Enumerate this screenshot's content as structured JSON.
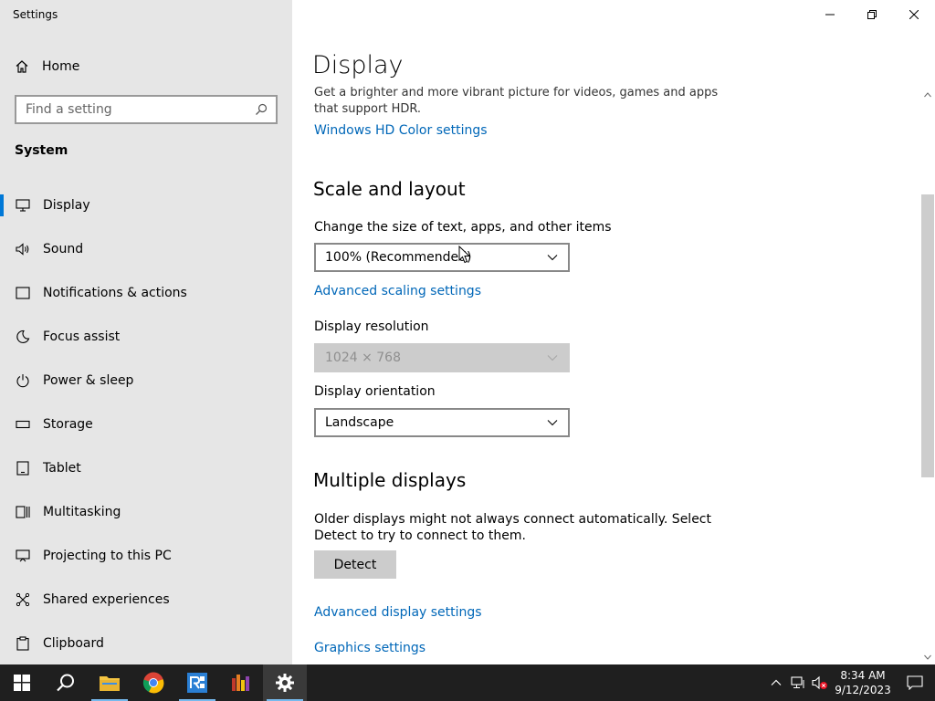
{
  "app": {
    "title": "Settings"
  },
  "sidebar": {
    "home_label": "Home",
    "search_placeholder": "Find a setting",
    "section": "System",
    "items": [
      {
        "label": "Display",
        "icon": "monitor-icon"
      },
      {
        "label": "Sound",
        "icon": "speaker-icon"
      },
      {
        "label": "Notifications & actions",
        "icon": "notification-icon"
      },
      {
        "label": "Focus assist",
        "icon": "moon-icon"
      },
      {
        "label": "Power & sleep",
        "icon": "power-icon"
      },
      {
        "label": "Storage",
        "icon": "storage-icon"
      },
      {
        "label": "Tablet",
        "icon": "tablet-icon"
      },
      {
        "label": "Multitasking",
        "icon": "multitasking-icon"
      },
      {
        "label": "Projecting to this PC",
        "icon": "projecting-icon"
      },
      {
        "label": "Shared experiences",
        "icon": "shared-icon"
      },
      {
        "label": "Clipboard",
        "icon": "clipboard-icon"
      }
    ]
  },
  "main": {
    "title": "Display",
    "hdr_description": "Get a brighter and more vibrant picture for videos, games and apps that support HDR.",
    "hdr_link": "Windows HD Color settings",
    "scale": {
      "heading": "Scale and layout",
      "size_label": "Change the size of text, apps, and other items",
      "size_value": "100% (Recommended)",
      "advanced_link": "Advanced scaling settings",
      "resolution_label": "Display resolution",
      "resolution_value": "1024 × 768",
      "orientation_label": "Display orientation",
      "orientation_value": "Landscape"
    },
    "multiple": {
      "heading": "Multiple displays",
      "description": "Older displays might not always connect automatically. Select Detect to try to connect to them.",
      "detect_label": "Detect",
      "advanced_display_link": "Advanced display settings",
      "graphics_link": "Graphics settings"
    }
  },
  "taskbar": {
    "time": "8:34 AM",
    "date": "9/12/2023",
    "apps": [
      "start-icon",
      "search-icon",
      "file-explorer-icon",
      "chrome-icon",
      "app-icon",
      "app-icon",
      "settings-icon"
    ]
  },
  "colors": {
    "accent": "#0078d7",
    "link": "#0067b8",
    "sidebar_bg": "#e6e6e6",
    "taskbar_bg": "#1f1f1f"
  }
}
